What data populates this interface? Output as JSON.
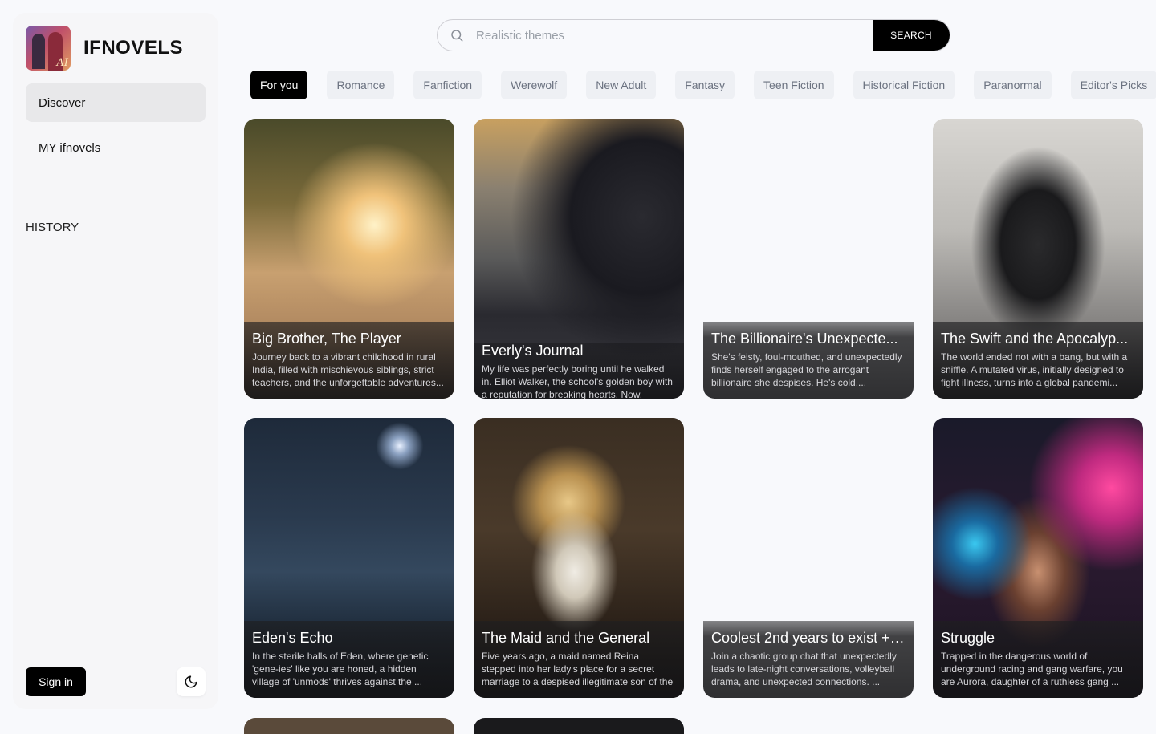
{
  "brand": {
    "name": "IFNOVELS",
    "logo_mark": "AI"
  },
  "sidebar": {
    "nav": [
      {
        "label": "Discover",
        "active": true
      },
      {
        "label": "MY ifnovels",
        "active": false
      }
    ],
    "history_label": "HISTORY",
    "signin_label": "Sign in",
    "theme_icon": "moon-icon"
  },
  "search": {
    "placeholder": "Realistic themes",
    "button_label": "SEARCH",
    "icon": "search-icon"
  },
  "tags": [
    {
      "label": "For you",
      "active": true
    },
    {
      "label": "Romance"
    },
    {
      "label": "Fanfiction"
    },
    {
      "label": "Werewolf"
    },
    {
      "label": "New Adult"
    },
    {
      "label": "Fantasy"
    },
    {
      "label": "Teen Fiction"
    },
    {
      "label": "Historical Fiction"
    },
    {
      "label": "Paranormal"
    },
    {
      "label": "Editor's Picks"
    }
  ],
  "cards": [
    {
      "title": "Big Brother, The Player",
      "description": "Journey back to a vibrant childhood in rural India, filled with mischievous siblings, strict teachers, and the unforgettable adventures..."
    },
    {
      "title": "Everly's Journal",
      "description": "My life was perfectly boring until he walked in. Elliot Walker, the school's golden boy with a reputation for breaking hearts. Now,"
    },
    {
      "title": "The Billionaire's Unexpecte...",
      "description": "She's feisty, foul-mouthed, and unexpectedly finds herself engaged to the arrogant billionaire she despises. He's cold,..."
    },
    {
      "title": "The Swift and the Apocalyp...",
      "description": "The world ended not with a bang, but with a sniffle. A mutated virus, initially designed to fight illness, turns into a global pandemi..."
    },
    {
      "title": "Eden's Echo",
      "description": "In the sterile halls of Eden, where genetic 'gene-ies' like you are honed, a hidden village of 'unmods' thrives against the ..."
    },
    {
      "title": "The Maid and the General",
      "description": "Five years ago, a maid named Reina stepped into her lady's place for a secret marriage to a despised illegitimate son of the emperor. ..."
    },
    {
      "title": "Coolest 2nd years to exist + ...",
      "description": "Join a chaotic group chat that unexpectedly leads to late-night conversations, volleyball drama, and unexpected connections. ..."
    },
    {
      "title": "Struggle",
      "description": "Trapped in the dangerous world of underground racing and gang warfare, you are Aurora, daughter of a ruthless gang ..."
    }
  ]
}
